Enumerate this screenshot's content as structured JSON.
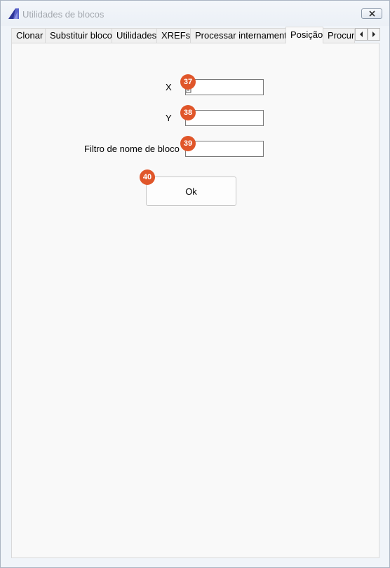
{
  "window": {
    "title": "Utilidades de blocos",
    "icon": "autocad-logo-icon",
    "close_icon": "close-icon"
  },
  "tabs": [
    {
      "label": "Clonar"
    },
    {
      "label": "Substituir bloco"
    },
    {
      "label": "Utilidades"
    },
    {
      "label": "XREFs"
    },
    {
      "label": "Processar internamente"
    },
    {
      "label": "Posição",
      "selected": true
    },
    {
      "label": "Procurar"
    }
  ],
  "tab_scroll": {
    "left_icon": "chevron-left-icon",
    "right_icon": "chevron-right-icon"
  },
  "form": {
    "x_label": "X",
    "x_value": "",
    "y_label": "Y",
    "y_value": "",
    "filter_label": "Filtro de nome de bloco",
    "filter_value": "",
    "ok_label": "Ok"
  },
  "markers": [
    "37",
    "38",
    "39",
    "40"
  ],
  "colors": {
    "marker": "#e0562a",
    "panel_background": "#f9f9f9",
    "title_text": "#a3a8ae"
  }
}
